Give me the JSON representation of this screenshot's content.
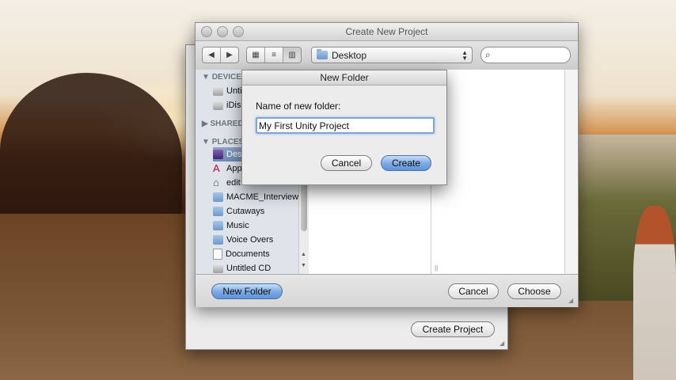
{
  "main_window": {
    "title": "Create New Project",
    "location": "Desktop",
    "search_placeholder": ""
  },
  "sidebar": {
    "sections": [
      {
        "label": "DEVICES"
      },
      {
        "label": "SHARED"
      },
      {
        "label": "PLACES"
      }
    ],
    "devices": [
      {
        "label": "Untitled",
        "icon": "disk-icon"
      },
      {
        "label": "iDisk",
        "icon": "idisk-icon"
      }
    ],
    "places": [
      {
        "label": "Desktop",
        "icon": "desktop-icon",
        "selected": true
      },
      {
        "label": "Applications",
        "icon": "applications-icon"
      },
      {
        "label": "edit",
        "icon": "home-icon"
      },
      {
        "label": "MACME_Interviews",
        "icon": "folder-icon"
      },
      {
        "label": "Cutaways",
        "icon": "folder-icon"
      },
      {
        "label": "Music",
        "icon": "folder-icon"
      },
      {
        "label": "Voice Overs",
        "icon": "folder-icon"
      },
      {
        "label": "Documents",
        "icon": "document-icon"
      },
      {
        "label": "Untitled CD",
        "icon": "cd-icon"
      }
    ]
  },
  "buttons": {
    "new_folder": "New Folder",
    "cancel": "Cancel",
    "choose": "Choose",
    "create_project": "Create Project"
  },
  "dialog": {
    "title": "New Folder",
    "label": "Name of new folder:",
    "value": "My First Unity Project",
    "cancel": "Cancel",
    "create": "Create"
  },
  "colors": {
    "accent_blue": "#7aa8e3",
    "sidebar_bg": "#dee4ea",
    "selection": "#6f8ab3"
  }
}
